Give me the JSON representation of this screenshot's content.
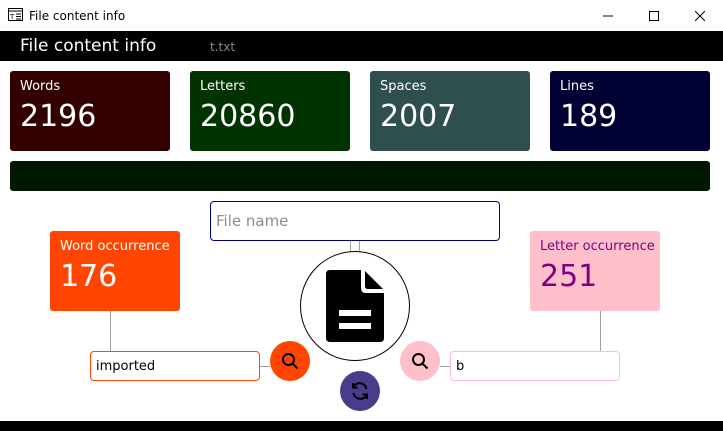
{
  "window": {
    "title": "File content info"
  },
  "header": {
    "title": "File content info",
    "file": "t.txt"
  },
  "stats": [
    {
      "label": "Words",
      "value": "2196"
    },
    {
      "label": "Letters",
      "value": "20860"
    },
    {
      "label": "Spaces",
      "value": "2007"
    },
    {
      "label": "Lines",
      "value": "189"
    }
  ],
  "file_input": {
    "placeholder": "File name",
    "value": ""
  },
  "word_occurrence": {
    "label": "Word occurrence",
    "value": "176",
    "query": "imported"
  },
  "letter_occurrence": {
    "label": "Letter occurrence",
    "value": "251",
    "query": "b"
  },
  "icons": {
    "app": "text-editor-icon",
    "file": "file-document-icon",
    "search": "search-icon",
    "refresh": "refresh-icon"
  },
  "colors": {
    "words": "#330000",
    "letters": "#003300",
    "spaces": "#2f4f4f",
    "lines": "#000033",
    "progress": "#001800",
    "word_accent": "#ff4500",
    "letter_accent": "#ffc0cb",
    "letter_text": "#800080",
    "refresh": "#483d8b",
    "file_border": "#000080"
  }
}
